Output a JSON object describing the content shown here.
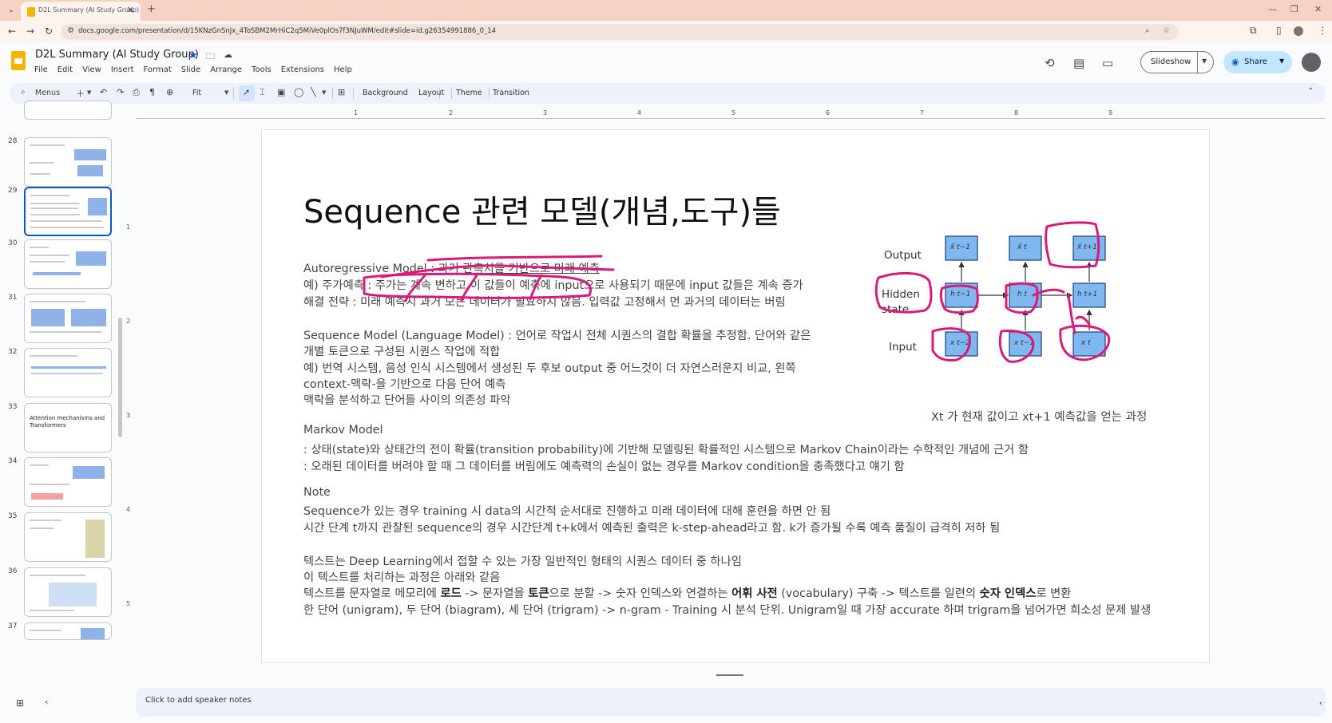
{
  "browser": {
    "tab_title": "D2L Summary (AI Study Group)",
    "url": "docs.google.com/presentation/d/15KNzGnSnJx_4ToSBM2MrHiC2q5MiVe0plOs7f3NJuWM/edit#slide=id.g26354991886_0_14"
  },
  "app": {
    "title": "D2L Summary (AI Study Group)",
    "menu": [
      "File",
      "Edit",
      "View",
      "Insert",
      "Format",
      "Slide",
      "Arrange",
      "Tools",
      "Extensions",
      "Help"
    ],
    "slideshow_label": "Slideshow",
    "share_label": "Share"
  },
  "toolbar": {
    "menus_label": "Menus",
    "zoom": "Fit",
    "background": "Background",
    "layout": "Layout",
    "theme": "Theme",
    "transition": "Transition"
  },
  "ruler": [
    "1",
    "2",
    "3",
    "4",
    "5",
    "6",
    "7",
    "8",
    "9"
  ],
  "vruler": [
    "1",
    "2",
    "3",
    "4",
    "5"
  ],
  "filmstrip": [
    {
      "num": "28",
      "text": ""
    },
    {
      "num": "29",
      "text": "",
      "selected": true
    },
    {
      "num": "30",
      "text": ""
    },
    {
      "num": "31",
      "text": ""
    },
    {
      "num": "32",
      "text": ""
    },
    {
      "num": "33",
      "text": "Attention mechanisms and Transformers"
    },
    {
      "num": "34",
      "text": ""
    },
    {
      "num": "35",
      "text": ""
    },
    {
      "num": "36",
      "text": ""
    },
    {
      "num": "37",
      "text": ""
    }
  ],
  "slide": {
    "title": "Sequence 관련 모델(개념,도구)들",
    "ar_title_a": "Autoregressive Model : ",
    "ar_title_b": "과거 관측치를 기반으로 미래 예측",
    "ar_ex": "예) 주가예측 : 주가는 계속 변하고 이 값들이 예측에 input으로 사용되기 때문에 input 값들은 계속 증가",
    "ar_sol": "해결 전략 : 미래 예측시 과거 모든 데이터가 필요하지 않음. 입력값 고정해서 먼 과거의 데이터는 버림",
    "sm_1": "Sequence Model (Language Model) : 언어로 작업시 전체 시퀀스의 결합 확률을 추정함. 단어와 같은",
    "sm_2": "개별 토큰으로 구성된 시퀀스 작업에 적합",
    "sm_3": "예) 번역 시스템, 음성 인식 시스템에서 생성된 두 후보 output 중 어느것이 더 자연스러운지 비교, 왼쪽",
    "sm_4": "context-맥락-을 기반으로 다음 단어 예측",
    "sm_5": "맥락을 분석하고 단어들 사이의 의존성 파악",
    "mk_title": "Markov Model",
    "mk_1": ": 상태(state)와 상태간의 전이 확률(transition probability)에 기반해 모델링된 확률적인 시스템으로 Markov Chain이라는 수학적인 개념에 근거 함",
    "mk_2": ": 오래된 데이터를 버려야 할 때 그 데이터를 버림에도 예측력의 손실이 없는 경우를 Markov condition을 충족했다고 얘기 함",
    "note_title": "Note",
    "note_1": "Sequence가 있는 경우 training 시 data의 시간적 순서대로 진행하고 미래 데이터에 대해 훈련을 하면 안 됨",
    "note_2": "시간 단계 t까지 관찰된 sequence의 경우 시간단계 t+k에서 예측된 출력은 k-step-ahead라고 함. k가 증가될 수록 예측 품질이 급격히 저하 됨",
    "tx_1": "텍스트는 Deep Learning에서 접할 수 있는 가장 일반적인 형태의 시퀀스 데이터 중 하나임",
    "tx_2": "이 텍스트를 처리하는 과정은 아래와 같음",
    "tx_3a": "텍스트를 문자열로 메모리에 ",
    "tx_3b": "로드",
    "tx_3c": " -> 문자열을 ",
    "tx_3d": "토큰",
    "tx_3e": "으로 분할 -> 숫자 인덱스와 연결하는 ",
    "tx_3f": "어휘 사전",
    "tx_3g": " (vocabulary) 구축 -> 텍스트를 일련의 ",
    "tx_3h": "숫자 인덱스",
    "tx_3i": "로 변환",
    "tx_4": "한 단어 (unigram), 두 단어 (biagram), 세 단어 (trigram) -> n-gram - Training 시 분석 단위. Unigram일 때 가장 accurate 하며 trigram을 넘어가면 희소성 문제 발생",
    "diagram": {
      "output_label": "Output",
      "hidden_label": "Hidden state",
      "input_label": "Input",
      "caption": "Xt 가 현재 값이고 xt+1 예측값을 얻는 과정",
      "outputs": [
        "x̂ t−1",
        "x̂ t",
        "x̂ t+1"
      ],
      "hiddens": [
        "h t−1",
        "h t",
        "h t+1"
      ],
      "inputs": [
        "x t−2",
        "x t−1",
        "x t"
      ]
    }
  },
  "notes_placeholder": "Click to add speaker notes",
  "colors": {
    "ink": "#d81b7a",
    "box_fill": "#7fb8f0",
    "box_border": "#1f3f7a",
    "accent": "#0b57d0"
  }
}
